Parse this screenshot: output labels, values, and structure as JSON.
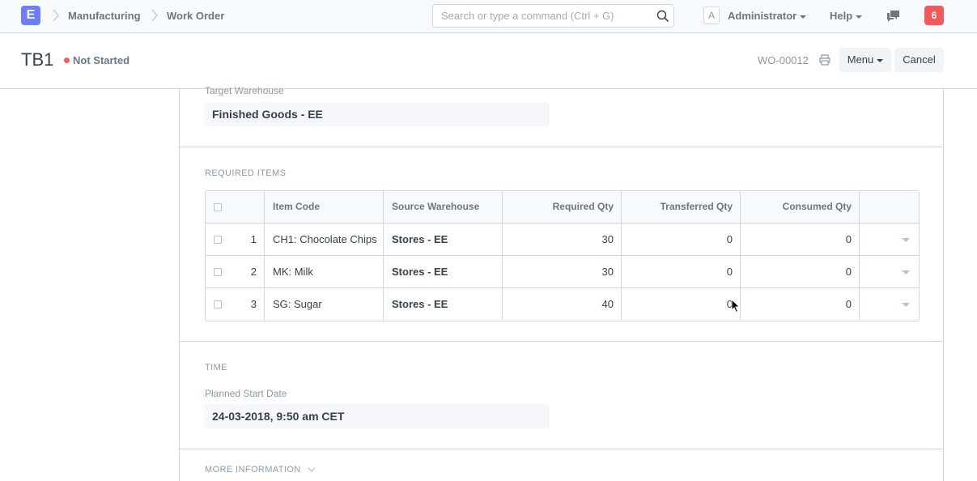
{
  "navbar": {
    "logo_letter": "E",
    "breadcrumbs": [
      "Manufacturing",
      "Work Order"
    ],
    "search_placeholder": "Search or type a command (Ctrl + G)",
    "avatar_letter": "A",
    "user_label": "Administrator",
    "help_label": "Help",
    "notification_count": "6",
    "icons": [
      "search-icon",
      "chat-icon"
    ]
  },
  "page_head": {
    "title": "TB1",
    "status": "Not Started",
    "status_color": "#ff5858",
    "doc_name": "WO-00012",
    "menu_label": "Menu",
    "cancel_label": "Cancel"
  },
  "form": {
    "target_warehouse_label": "Target Warehouse",
    "target_warehouse_value": "Finished Goods - EE",
    "required_items_heading": "REQUIRED ITEMS",
    "time_heading": "TIME",
    "planned_start_label": "Planned Start Date",
    "planned_start_value": "24-03-2018, 9:50 am CET",
    "more_info_heading": "MORE INFORMATION"
  },
  "items_table": {
    "columns": [
      "Item Code",
      "Source Warehouse",
      "Required Qty",
      "Transferred Qty",
      "Consumed Qty"
    ],
    "rows": [
      {
        "idx": "1",
        "item_code": "CH1: Chocolate Chips",
        "source_warehouse": "Stores - EE",
        "required_qty": "30",
        "transferred_qty": "0",
        "consumed_qty": "0"
      },
      {
        "idx": "2",
        "item_code": "MK: Milk",
        "source_warehouse": "Stores - EE",
        "required_qty": "30",
        "transferred_qty": "0",
        "consumed_qty": "0"
      },
      {
        "idx": "3",
        "item_code": "SG: Sugar",
        "source_warehouse": "Stores - EE",
        "required_qty": "40",
        "transferred_qty": "0",
        "consumed_qty": "0"
      }
    ]
  }
}
